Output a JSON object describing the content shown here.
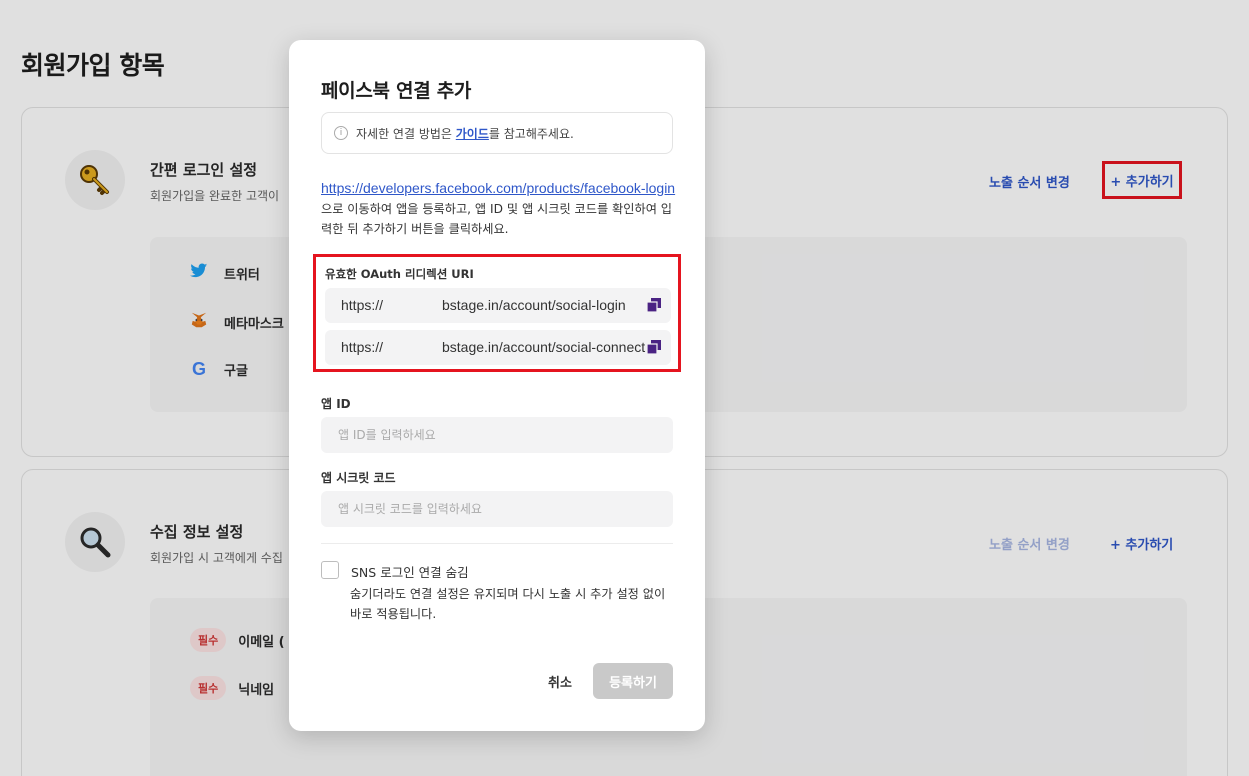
{
  "page": {
    "title": "회원가입 항목"
  },
  "cards": [
    {
      "title": "간편 로그인 설정",
      "desc": "회원가입을 완료한 고객이",
      "order_label": "노출 순서 변경",
      "add_label": "+ 추가하기",
      "icon": "key-icon",
      "items": [
        {
          "label": "트위터",
          "icon": "twitter-icon"
        },
        {
          "label": "메타마스크",
          "icon": "metamask-icon"
        },
        {
          "label": "구글",
          "icon": "google-icon"
        }
      ]
    },
    {
      "title": "수집 정보 설정",
      "desc": "회원가입 시 고객에게 수집",
      "order_label": "노출 순서 변경",
      "add_label": "+ 추가하기",
      "icon": "magnifier-icon",
      "items": [
        {
          "badge": "필수",
          "label": "이메일 ("
        },
        {
          "badge": "필수",
          "label": "닉네임"
        }
      ]
    }
  ],
  "modal": {
    "title": "페이스북 연결 추가",
    "info": {
      "prefix": "자세한 연결 방법은 ",
      "link": "가이드",
      "suffix": "를 참고해주세요."
    },
    "desc": {
      "url": "https://developers.facebook.com/products/facebook-login",
      "text": " 으로 이동하여 앱을 등록하고, 앱 ID 및 앱 시크릿 코드를 확인하여 입력한 뒤 추가하기 버튼을 클릭하세요."
    },
    "redirect": {
      "label": "유효한 OAuth 리디렉션 URI",
      "uris": [
        {
          "proto": "https://",
          "path": "bstage.in/account/social-login"
        },
        {
          "proto": "https://",
          "path": "bstage.in/account/social-connect"
        }
      ]
    },
    "app_id": {
      "label": "앱 ID",
      "placeholder": "앱 ID를 입력하세요",
      "value": ""
    },
    "app_secret": {
      "label": "앱 시크릿 코드",
      "placeholder": "앱 시크릿 코드를 입력하세요",
      "value": ""
    },
    "hide": {
      "label": "SNS 로그인 연결 숨김",
      "desc": "숨기더라도 연결 설정은 유지되며 다시 노출 시 추가 설정 없이 바로 적용됩니다.",
      "checked": false
    },
    "buttons": {
      "cancel": "취소",
      "submit": "등록하기"
    }
  },
  "colors": {
    "accent": "#2f57c9",
    "highlight": "#e5141f",
    "copy_icon": "#4a2283",
    "disabled_button": "#c9c9c9"
  }
}
